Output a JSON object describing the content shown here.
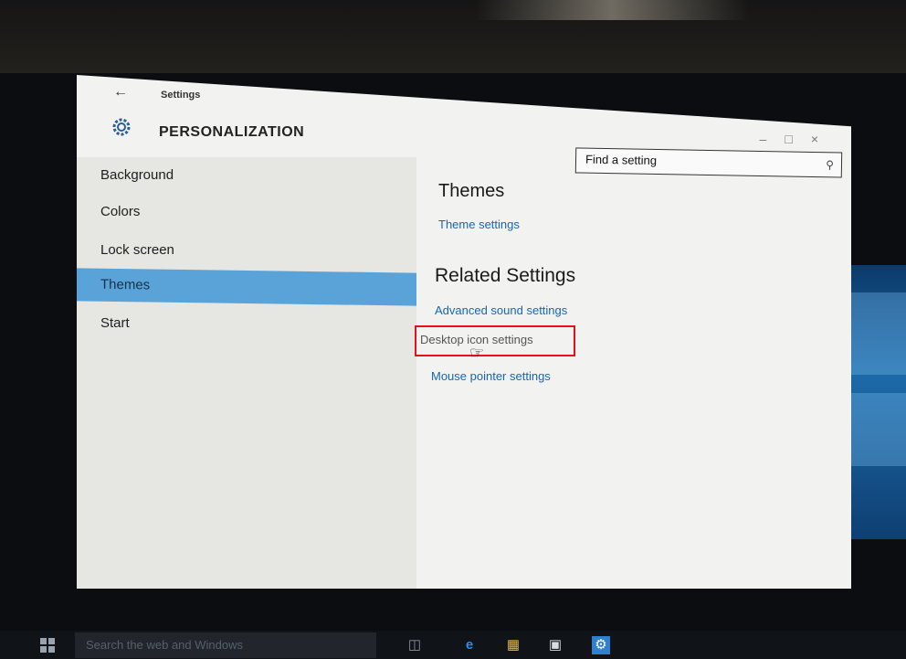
{
  "window": {
    "back_icon": "back-arrow-icon",
    "title": "Settings",
    "section_icon": "gear-icon",
    "section_title": "PERSONALIZATION"
  },
  "search": {
    "placeholder": "Find a setting",
    "icon": "search-icon"
  },
  "sidebar": {
    "items": [
      {
        "label": "Background",
        "selected": false
      },
      {
        "label": "Colors",
        "selected": false
      },
      {
        "label": "Lock screen",
        "selected": false
      },
      {
        "label": "Themes",
        "selected": true
      },
      {
        "label": "Start",
        "selected": false
      }
    ]
  },
  "content": {
    "themes_heading": "Themes",
    "theme_settings_link": "Theme settings",
    "related_heading": "Related Settings",
    "related_links": [
      "Advanced sound settings",
      "Desktop icon settings",
      "Mouse pointer settings"
    ]
  },
  "taskbar": {
    "search_placeholder": "Search the web and Windows"
  },
  "colors": {
    "accent": "#5aa3d8",
    "link": "#1466b5",
    "highlight": "#e3121b"
  }
}
